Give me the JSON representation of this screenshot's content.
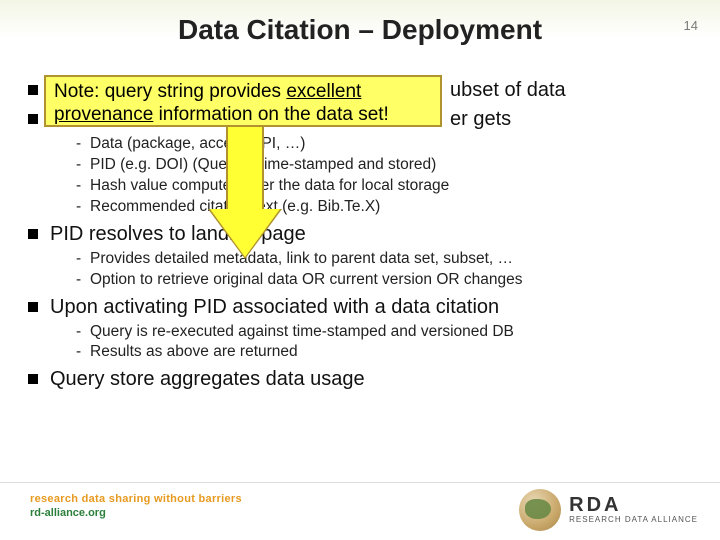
{
  "page_number": "14",
  "title": "Data Citation – Deployment",
  "note": {
    "line1_prefix": "Note: query string provides ",
    "line1_em": "excellent",
    "line2_em": "provenance",
    "line2_rest": " information on the data set!"
  },
  "bullets": {
    "b1_suffix": "ubset of data",
    "b2_suffix": "er gets",
    "b2_sub1": "Data (package, access API, …)",
    "b2_sub2": "PID (e.g. DOI)  (Query is time-stamped and stored)",
    "b2_sub3": "Hash value computed over the data for local storage",
    "b2_sub4": "Recommended citation text (e.g. Bib.Te.X)",
    "b3": "PID resolves to landing page",
    "b3_sub1": "Provides detailed metadata, link to parent data set, subset, …",
    "b3_sub2": "Option to retrieve original data OR current version OR changes",
    "b4": "Upon activating PID associated with a data citation",
    "b4_sub1": "Query is re-executed against time-stamped and versioned DB",
    "b4_sub2": "Results as above are returned",
    "b5": "Query store aggregates data usage"
  },
  "footer": {
    "tagline1": "research data sharing without barriers",
    "tagline2": "rd-alliance.org",
    "logo_big": "RDA",
    "logo_small": "RESEARCH DATA ALLIANCE"
  }
}
